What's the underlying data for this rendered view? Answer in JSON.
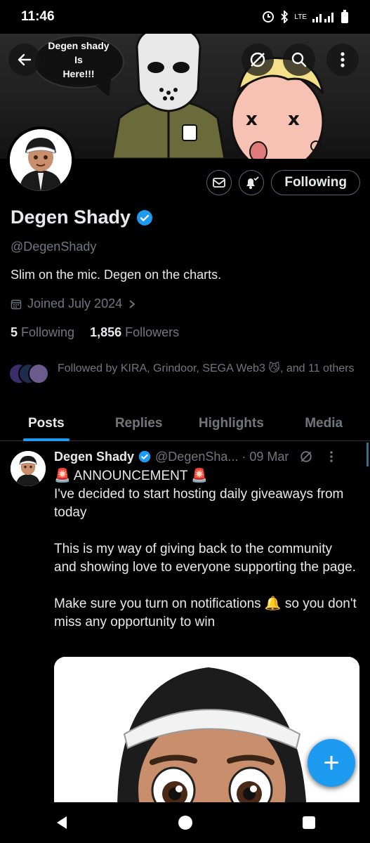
{
  "status": {
    "time": "11:46",
    "network": "LTE"
  },
  "banner": {
    "speech_text": "Degen shady\nIs\nHere!!!"
  },
  "profile": {
    "name": "Degen Shady",
    "handle": "@DegenShady",
    "bio": "Slim on the mic. Degen on the charts.",
    "joined": "Joined July 2024",
    "following_count": "5",
    "following_label": "Following",
    "followers_count": "1,856",
    "followers_label": "Followers",
    "followed_by": "Followed by KIRA, Grindoor, SEGA Web3 😼, and 11 others",
    "follow_button_label": "Following"
  },
  "tabs": [
    {
      "label": "Posts",
      "active": true
    },
    {
      "label": "Replies",
      "active": false
    },
    {
      "label": "Highlights",
      "active": false
    },
    {
      "label": "Media",
      "active": false
    }
  ],
  "post": {
    "author": "Degen Shady",
    "handle": "@DegenSha...",
    "separator": "·",
    "date": "09 Mar",
    "paragraphs": [
      "🚨 ANNOUNCEMENT 🚨\nI've decided to start hosting daily giveaways from today",
      "This is my way of giving back to the community and showing love to everyone supporting the page.",
      "Make sure you turn on notifications 🔔 so you don't miss any opportunity to win"
    ]
  },
  "fab": {
    "icon": "plus-icon",
    "label": "+"
  },
  "colors": {
    "accent": "#1d9bf0",
    "background": "#000000",
    "text_primary": "#e7e9ea",
    "text_secondary": "#71767b"
  }
}
